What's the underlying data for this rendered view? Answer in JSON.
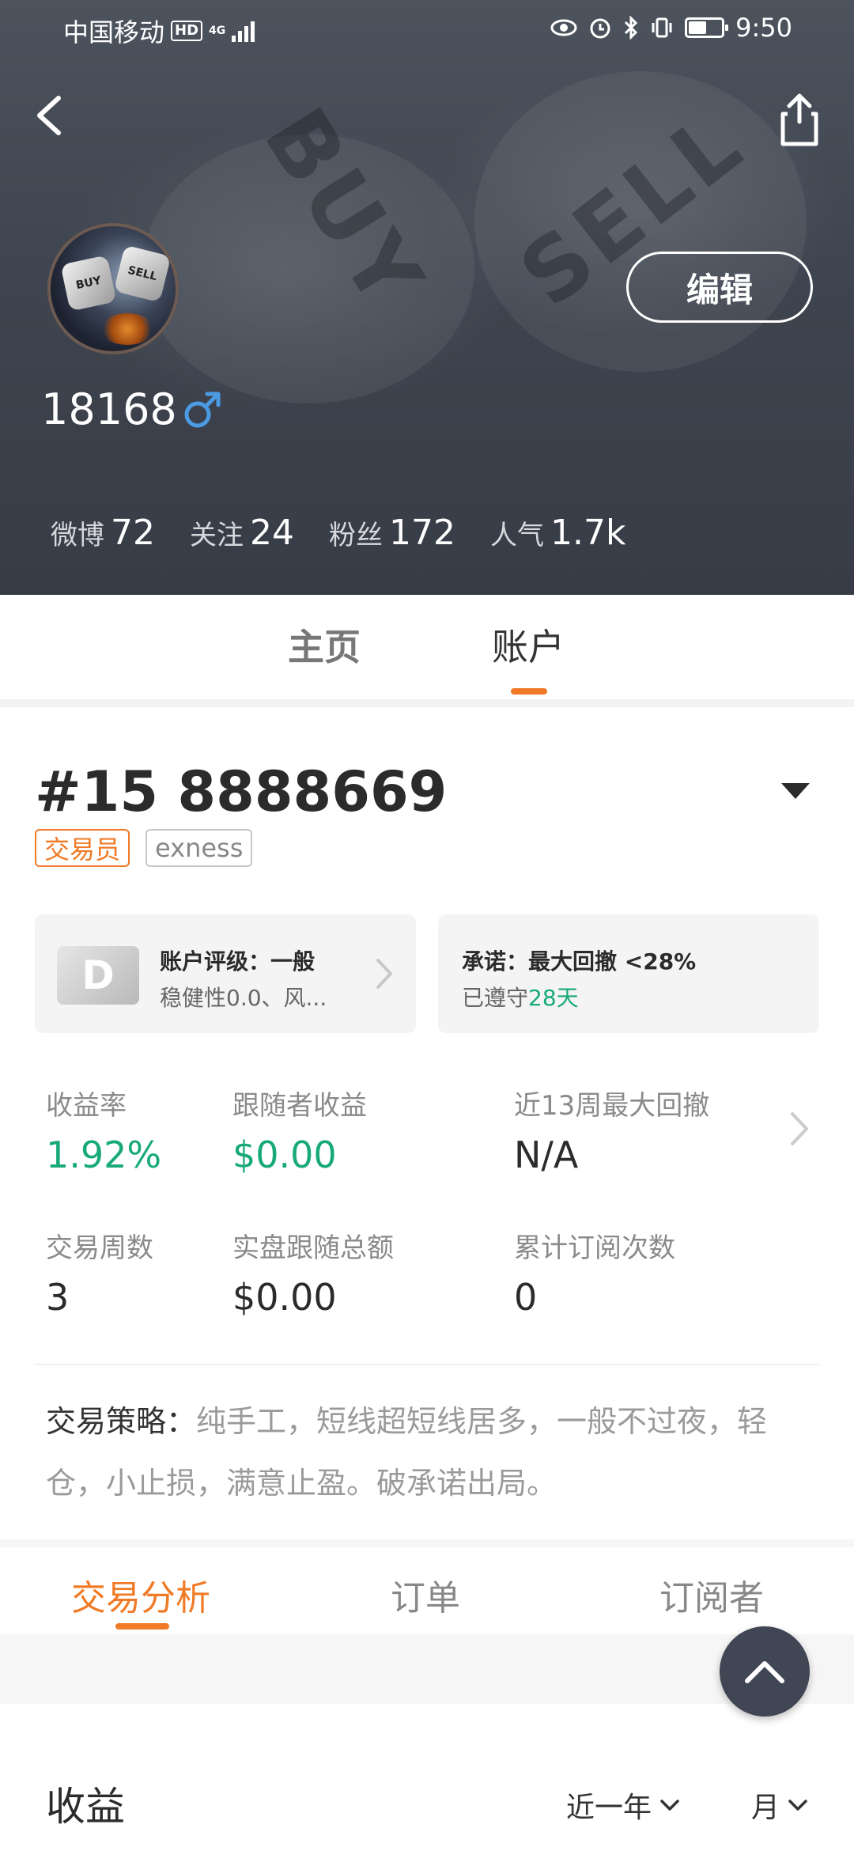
{
  "status_bar": {
    "carrier": "中国移动",
    "hd": "HD",
    "network": "4G",
    "time": "9:50"
  },
  "profile": {
    "username": "18168",
    "edit_label": "编辑",
    "avatar_die_left": "BUY",
    "avatar_die_right": "SELL",
    "stats": [
      {
        "label": "微博",
        "value": "72"
      },
      {
        "label": "关注",
        "value": "24"
      },
      {
        "label": "粉丝",
        "value": "172"
      },
      {
        "label": "人气",
        "value": "1.7k"
      }
    ]
  },
  "profile_tabs": [
    {
      "label": "主页"
    },
    {
      "label": "账户"
    }
  ],
  "account": {
    "number": "#15 8888669",
    "tags": [
      "交易员",
      "exness"
    ],
    "rating_badge": "D",
    "rating_title": "账户评级：一般",
    "rating_sub": "稳健性0.0、风...",
    "promise_title": "承诺：最大回撤 <28%",
    "promise_prefix": "已遵守",
    "promise_days": "28天",
    "metrics": [
      {
        "label": "收益率",
        "value": "1.92%"
      },
      {
        "label": "跟随者收益",
        "value": "$0.00"
      },
      {
        "label": "近13周最大回撤",
        "value": "N/A"
      },
      {
        "label": "交易周数",
        "value": "3"
      },
      {
        "label": "实盘跟随总额",
        "value": "$0.00"
      },
      {
        "label": "累计订阅次数",
        "value": "0"
      }
    ],
    "strategy_label": "交易策略：",
    "strategy_text": "纯手工，短线超短线居多，一般不过夜，轻仓，小止损，满意止盈。破承诺出局。"
  },
  "sub_tabs": [
    {
      "label": "交易分析"
    },
    {
      "label": "订单"
    },
    {
      "label": "订阅者"
    }
  ],
  "earnings": {
    "title": "收益",
    "period_select": "近一年",
    "granularity_select": "月"
  },
  "colors": {
    "accent": "#f07a26",
    "positive": "#17a97a",
    "header_bg": "#3f4550"
  },
  "battery_level": 0.55
}
